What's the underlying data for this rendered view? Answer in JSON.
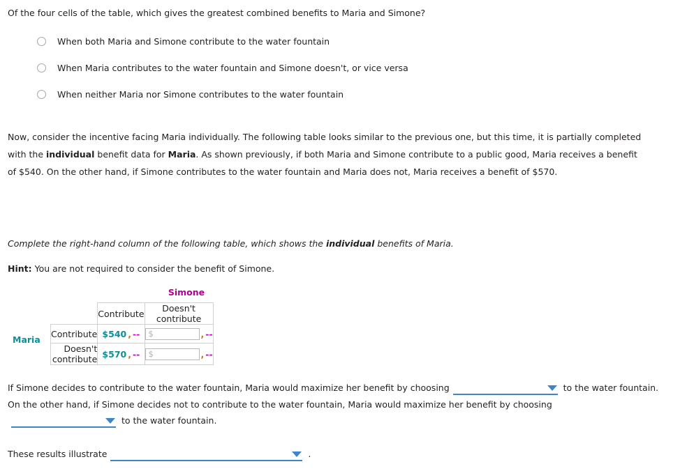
{
  "question": {
    "prompt": "Of the four cells of the table, which gives the greatest combined benefits to Maria and Simone?",
    "choices": [
      {
        "label": "When both Maria and Simone contribute to the water fountain",
        "icon": "radio-unselected-icon"
      },
      {
        "label": "When Maria contributes to the water fountain and Simone doesn't, or vice versa",
        "icon": "radio-unselected-icon"
      },
      {
        "label": "When neither Maria nor Simone contributes to the water fountain",
        "icon": "radio-unselected-icon"
      }
    ]
  },
  "narrative": {
    "part1": "Now, consider the incentive facing Maria individually. The following table looks similar to the previous one, but this time, it is partially completed with the ",
    "bold1": "individual",
    "part2": " benefit data for ",
    "bold2": "Maria",
    "part3": ". As shown previously, if both Maria and Simone contribute to a public good, Maria receives a benefit of $540. On the other hand, if Simone contributes to the water fountain and Maria does not, Maria receives a benefit of $570."
  },
  "instruction": {
    "part1": "Complete the right-hand column of the following table, which shows the ",
    "bold": "individual",
    "part2": " benefits of Maria."
  },
  "hint": {
    "label": "Hint:",
    "text": " You are not required to consider the benefit of Simone."
  },
  "matrix": {
    "column_player": "Simone",
    "row_player": "Maria",
    "column_headers": [
      "Contribute",
      "Doesn't contribute"
    ],
    "row_headers": [
      "Contribute",
      "Doesn't contribute"
    ],
    "colors": {
      "column_player": "#b2008f",
      "row_player": "#0a8f99",
      "maria_value": "#0a8f99",
      "simone_value": "#cc00cc"
    },
    "cells": [
      {
        "maria_value": "$540",
        "separator": ",",
        "simone_value": "--",
        "editable": false
      },
      {
        "maria_value": "",
        "maria_placeholder": "$",
        "separator": ",",
        "simone_value": "--",
        "editable": true
      },
      {
        "maria_value": "$570",
        "separator": ",",
        "simone_value": "--",
        "editable": false
      },
      {
        "maria_value": "",
        "maria_placeholder": "$",
        "separator": ",",
        "simone_value": "--",
        "editable": true
      }
    ]
  },
  "conclusion": {
    "line1_before": "If Simone decides to contribute to the water fountain, Maria would maximize her benefit by choosing",
    "dropdown1_value": "",
    "line1_after": "to the water fountain.",
    "line2": "On the other hand, if Simone decides not to contribute to the water fountain, Maria would maximize her benefit by choosing",
    "dropdown2_value": "",
    "line3_after": "to the water fountain.",
    "line4_before": "These results illustrate",
    "dropdown3_value": "",
    "line4_after": ".",
    "dropdown_color": "#3d85c6",
    "dropdown_icon": "chevron-down-icon"
  }
}
